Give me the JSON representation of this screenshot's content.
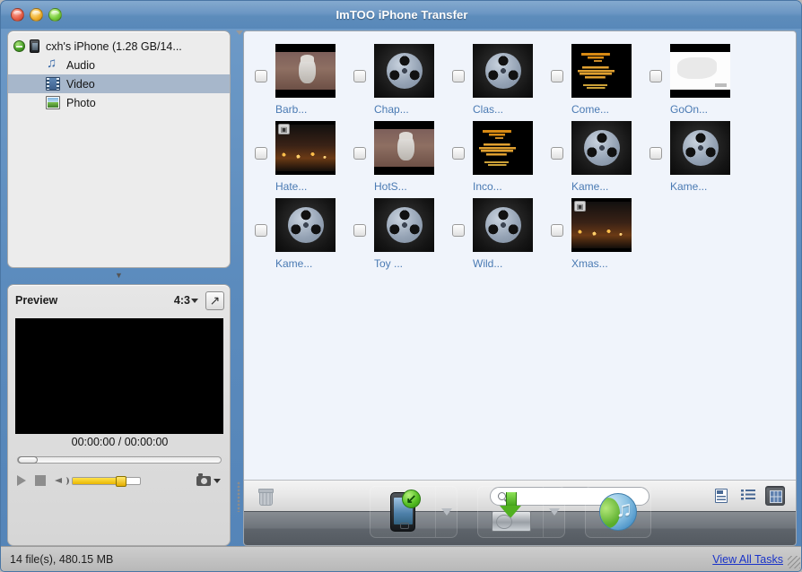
{
  "window": {
    "title": "ImTOO iPhone Transfer",
    "traffic_lights": [
      "close-button",
      "minimize-button",
      "zoom-button"
    ]
  },
  "sidebar": {
    "device": {
      "label": "cxh's iPhone (1.28 GB/14...",
      "eject_icon": "eject-icon",
      "device_icon": "iphone-icon"
    },
    "items": [
      {
        "label": "Audio",
        "icon": "music-note-icon",
        "selected": false
      },
      {
        "label": "Video",
        "icon": "film-strip-icon",
        "selected": true
      },
      {
        "label": "Photo",
        "icon": "photo-icon",
        "selected": false
      }
    ],
    "collapse_caret": "▼"
  },
  "preview": {
    "title": "Preview",
    "aspect_ratio": "4:3",
    "expand_icon": "expand-arrow-icon",
    "time": "00:00:00 / 00:00:00",
    "seek_position_percent": 0,
    "volume_percent": 70,
    "controls": {
      "play": "play-button",
      "stop": "stop-button",
      "speaker": "speaker-icon",
      "snapshot": "camera-snapshot-button"
    }
  },
  "grid": {
    "rows": [
      [
        {
          "label": "Barb...",
          "thumb": "cat",
          "checked": false
        },
        {
          "label": "Chap...",
          "thumb": "reel",
          "checked": false
        },
        {
          "label": "Clas...",
          "thumb": "reel",
          "checked": false
        },
        {
          "label": "Come...",
          "thumb": "text",
          "checked": false
        },
        {
          "label": "GoOn...",
          "thumb": "white",
          "checked": false
        }
      ],
      [
        {
          "label": "Hate...",
          "thumb": "night",
          "checked": false
        },
        {
          "label": "HotS...",
          "thumb": "cat",
          "checked": false
        },
        {
          "label": "Inco...",
          "thumb": "text",
          "checked": false
        },
        {
          "label": "Kame...",
          "thumb": "reel",
          "checked": false
        },
        {
          "label": "Kame...",
          "thumb": "reel",
          "checked": false
        }
      ],
      [
        {
          "label": "Kame...",
          "thumb": "reel",
          "checked": false
        },
        {
          "label": "Toy ...",
          "thumb": "reel",
          "checked": false
        },
        {
          "label": "Wild...",
          "thumb": "reel",
          "checked": false
        },
        {
          "label": "Xmas...",
          "thumb": "night",
          "checked": false
        }
      ]
    ]
  },
  "toolbar": {
    "trash_icon": "trash-icon",
    "search": {
      "value": "",
      "placeholder": "",
      "icon": "search-icon",
      "caret": "dropdown-caret-icon"
    },
    "views": [
      {
        "name": "detail-view-button",
        "icon": "detail-pane-icon",
        "active": false
      },
      {
        "name": "list-view-button",
        "icon": "list-icon",
        "active": false
      },
      {
        "name": "grid-view-button",
        "icon": "grid-icon",
        "active": true
      }
    ]
  },
  "actions": [
    {
      "name": "export-to-device-button",
      "icon": "iphone-with-green-arrow-icon",
      "has_dropdown": true
    },
    {
      "name": "export-to-computer-button",
      "icon": "harddrive-with-green-arrow-icon",
      "has_dropdown": true
    },
    {
      "name": "export-to-itunes-button",
      "icon": "itunes-icon",
      "has_dropdown": false
    }
  ],
  "statusbar": {
    "text": "14 file(s), 480.15 MB",
    "tasks_link": "View All Tasks"
  },
  "colors": {
    "title_bar": "#5b8bbd",
    "accent_link": "#1a33c8",
    "thumb_label": "#4a7ab3",
    "selection": "#a7b7cb"
  }
}
